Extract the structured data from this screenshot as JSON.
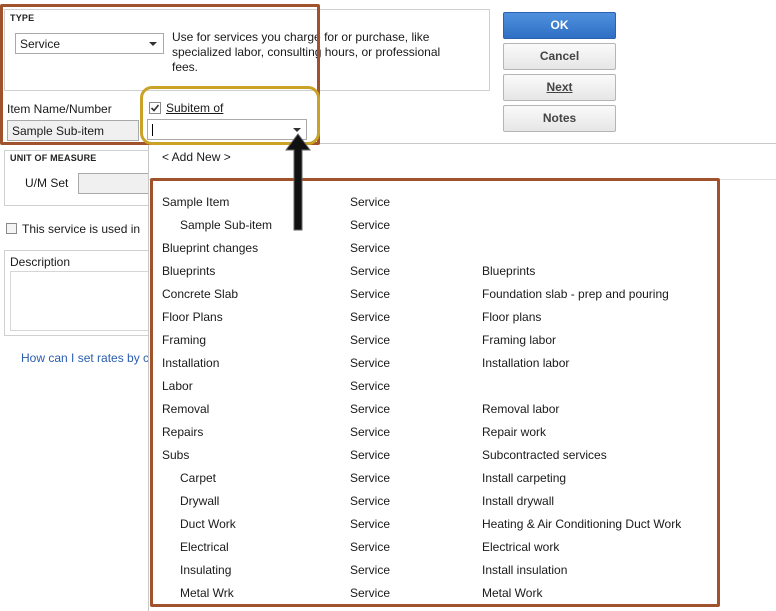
{
  "type_section": {
    "heading": "TYPE",
    "selected": "Service",
    "description": "Use for services you charge for or purchase, like specialized labor, consulting hours, or professional fees."
  },
  "item": {
    "name_label": "Item Name/Number",
    "name_value": "Sample Sub-item",
    "subitem_label": "Subitem of",
    "subitem_checked": true,
    "subitem_value": ""
  },
  "uom": {
    "heading": "UNIT OF MEASURE",
    "set_label": "U/M Set"
  },
  "assemblies_text": "This service is used in",
  "description_label": "Description",
  "help_link": "How can I set rates by c",
  "buttons": {
    "ok": "OK",
    "cancel": "Cancel",
    "next": "Next",
    "notes": "Notes"
  },
  "dropdown": {
    "add_new": "< Add New >",
    "rows": [
      {
        "name": "Sample Item",
        "type": "Service",
        "desc": "",
        "sub": false
      },
      {
        "name": "Sample Sub-item",
        "type": "Service",
        "desc": "",
        "sub": true
      },
      {
        "name": "Blueprint changes",
        "type": "Service",
        "desc": "",
        "sub": false
      },
      {
        "name": "Blueprints",
        "type": "Service",
        "desc": "Blueprints",
        "sub": false
      },
      {
        "name": "Concrete Slab",
        "type": "Service",
        "desc": "Foundation slab - prep and pouring",
        "sub": false
      },
      {
        "name": "Floor Plans",
        "type": "Service",
        "desc": "Floor plans",
        "sub": false
      },
      {
        "name": "Framing",
        "type": "Service",
        "desc": "Framing labor",
        "sub": false
      },
      {
        "name": "Installation",
        "type": "Service",
        "desc": "Installation labor",
        "sub": false
      },
      {
        "name": "Labor",
        "type": "Service",
        "desc": "",
        "sub": false
      },
      {
        "name": "Removal",
        "type": "Service",
        "desc": "Removal labor",
        "sub": false
      },
      {
        "name": "Repairs",
        "type": "Service",
        "desc": "Repair work",
        "sub": false
      },
      {
        "name": "Subs",
        "type": "Service",
        "desc": "Subcontracted services",
        "sub": false
      },
      {
        "name": "Carpet",
        "type": "Service",
        "desc": "Install carpeting",
        "sub": true
      },
      {
        "name": "Drywall",
        "type": "Service",
        "desc": "Install drywall",
        "sub": true
      },
      {
        "name": "Duct Work",
        "type": "Service",
        "desc": "Heating & Air Conditioning Duct Work",
        "sub": true
      },
      {
        "name": "Electrical",
        "type": "Service",
        "desc": "Electrical work",
        "sub": true
      },
      {
        "name": "Insulating",
        "type": "Service",
        "desc": "Install insulation",
        "sub": true
      },
      {
        "name": "Metal Wrk",
        "type": "Service",
        "desc": "Metal Work",
        "sub": true
      }
    ]
  },
  "colors": {
    "highlight_brown": "#a0522d",
    "highlight_gold": "#c9a227",
    "ok_button": "#3a7bd5",
    "link": "#2a5db0"
  }
}
